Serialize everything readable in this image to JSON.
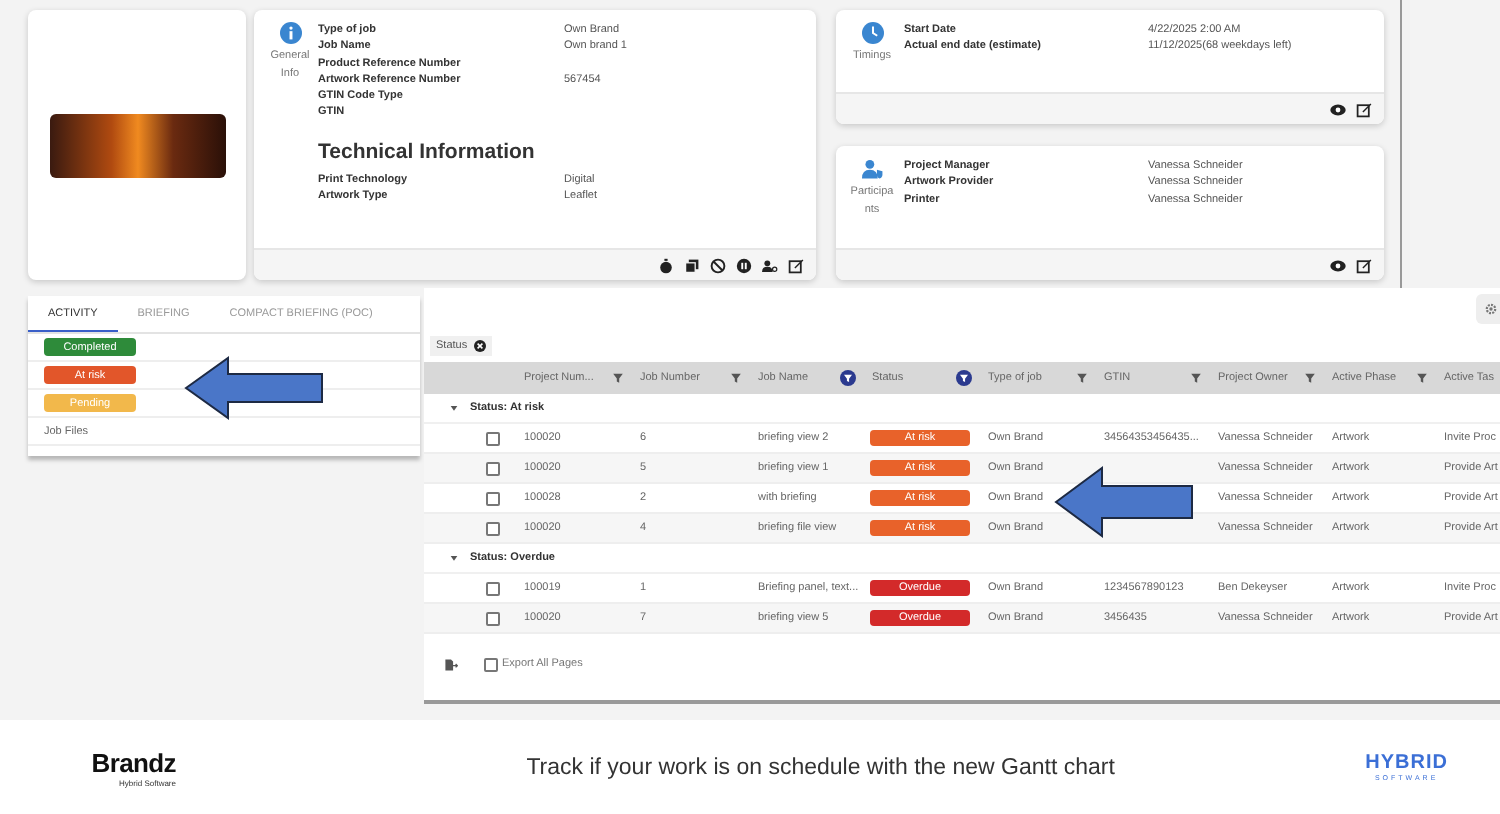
{
  "general_info": {
    "section_label": "General Info",
    "fields": [
      {
        "label": "Type of job",
        "value": "Own Brand"
      },
      {
        "label": "Job Name",
        "value": "Own brand 1"
      },
      {
        "label": "Product Reference Number"
      },
      {
        "label": "Artwork Reference Number",
        "value": "567454"
      },
      {
        "label": "GTIN Code Type"
      },
      {
        "label": "GTIN"
      }
    ],
    "technical_title": "Technical Information",
    "technical_fields": [
      {
        "label": "Print Technology",
        "value": "Digital"
      },
      {
        "label": "Artwork Type",
        "value": "Leaflet"
      }
    ]
  },
  "timings": {
    "section_label": "Timings",
    "fields": [
      {
        "label": "Start Date",
        "value": "4/22/2025 2:00 AM"
      },
      {
        "label": "Actual end date (estimate)",
        "value": "11/12/2025(68 weekdays left)"
      }
    ]
  },
  "participants": {
    "section_label": "Participants",
    "fields": [
      {
        "label": "Project Manager",
        "value": "Vanessa Schneider"
      },
      {
        "label": "Artwork Provider",
        "value": "Vanessa Schneider"
      },
      {
        "label": "Printer",
        "value": "Vanessa Schneider"
      }
    ]
  },
  "activity_tabs": [
    {
      "label": "ACTIVITY",
      "selected": true
    },
    {
      "label": "BRIEFING",
      "selected": false
    },
    {
      "label": "COMPACT BRIEFING (POC)",
      "selected": false
    }
  ],
  "status_legend": [
    {
      "label": "Completed",
      "color": "#2e8b3a"
    },
    {
      "label": "At risk",
      "color": "#e2562a"
    },
    {
      "label": "Pending",
      "color": "#f2b84b"
    }
  ],
  "job_files": "Job Files",
  "table": {
    "filter_chip": "Status",
    "columns": [
      {
        "label": "Project Num...",
        "filter_active": false
      },
      {
        "label": "Job Number",
        "filter_active": false
      },
      {
        "label": "Job Name",
        "filter_active": true
      },
      {
        "label": "Status",
        "filter_active": true
      },
      {
        "label": "Type of job",
        "filter_active": false
      },
      {
        "label": "GTIN",
        "filter_active": false
      },
      {
        "label": "Project Owner",
        "filter_active": false
      },
      {
        "label": "Active Phase",
        "filter_active": false
      },
      {
        "label": "Active Tas"
      }
    ],
    "groups": [
      {
        "title": "Status: At risk",
        "expanded": true,
        "rows": [
          {
            "checked": false,
            "project": "100020",
            "job_number": "6",
            "job_name": "briefing view 2",
            "status": {
              "label": "At risk",
              "color": "#e8622a"
            },
            "type": "Own Brand",
            "gtin": "34564353456435...",
            "owner": "Vanessa Schneider",
            "phase": "Artwork",
            "task": "Invite Proc"
          },
          {
            "checked": false,
            "project": "100020",
            "job_number": "5",
            "job_name": "briefing view 1",
            "status": {
              "label": "At risk",
              "color": "#e8622a"
            },
            "type": "Own Brand",
            "owner": "Vanessa Schneider",
            "phase": "Artwork",
            "task": "Provide Art"
          },
          {
            "checked": false,
            "project": "100028",
            "job_number": "2",
            "job_name": "with briefing",
            "status": {
              "label": "At risk",
              "color": "#e8622a"
            },
            "type": "Own Brand",
            "owner": "Vanessa Schneider",
            "phase": "Artwork",
            "task": "Provide Art"
          },
          {
            "checked": false,
            "project": "100020",
            "job_number": "4",
            "job_name": "briefing file view",
            "status": {
              "label": "At risk",
              "color": "#e8622a"
            },
            "type": "Own Brand",
            "owner": "Vanessa Schneider",
            "phase": "Artwork",
            "task": "Provide Art"
          }
        ]
      },
      {
        "title": "Status: Overdue",
        "expanded": true,
        "rows": [
          {
            "checked": false,
            "project": "100019",
            "job_number": "1",
            "job_name": "Briefing panel, text...",
            "status": {
              "label": "Overdue",
              "color": "#d32a2a"
            },
            "type": "Own Brand",
            "gtin": "1234567890123",
            "owner": "Ben Dekeyser",
            "phase": "Artwork",
            "task": "Invite Proc"
          },
          {
            "checked": false,
            "project": "100020",
            "job_number": "7",
            "job_name": "briefing view 5",
            "status": {
              "label": "Overdue",
              "color": "#d32a2a"
            },
            "type": "Own Brand",
            "gtin": "3456435",
            "owner": "Vanessa Schneider",
            "phase": "Artwork",
            "task": "Provide Art"
          }
        ]
      }
    ],
    "export": {
      "label": "Export All Pages",
      "checked": false
    }
  },
  "footer": {
    "brand": "Brandz",
    "brand_sub": "Hybrid Software",
    "tagline": "Track if your work is on schedule with the new Gantt chart",
    "partner": "HYBRID",
    "partner_sub": "SOFTWARE"
  }
}
